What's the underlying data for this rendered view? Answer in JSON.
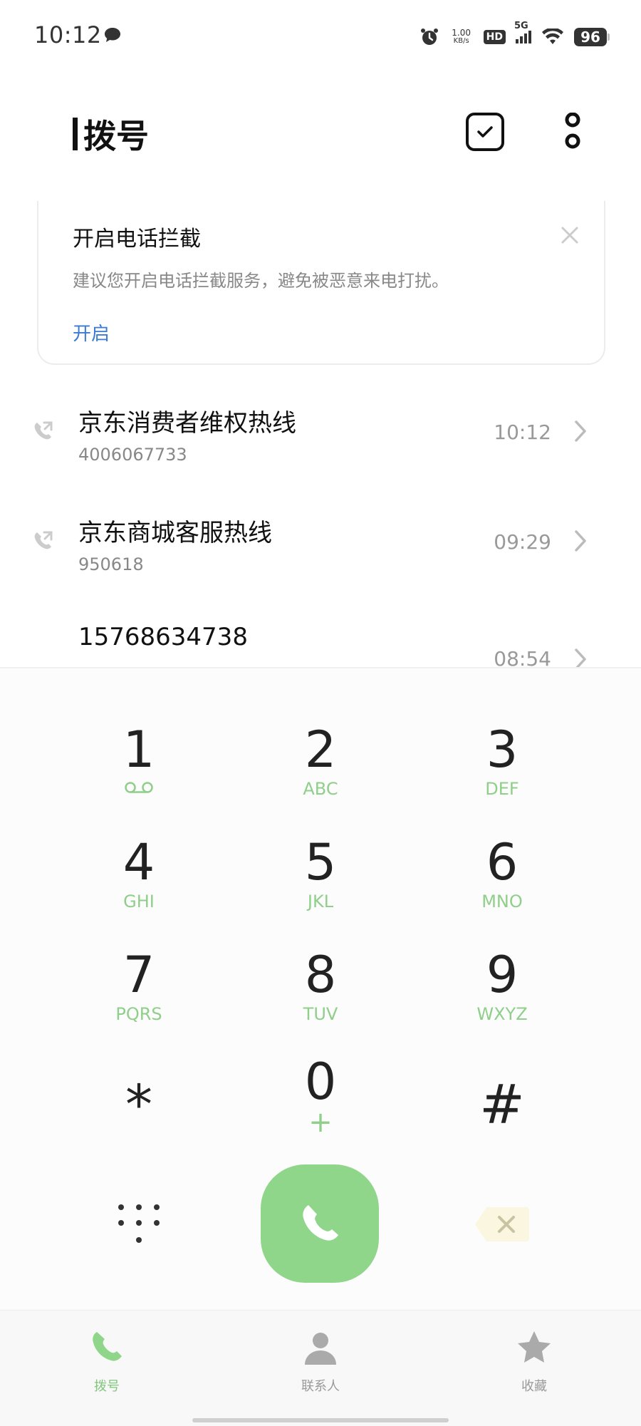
{
  "status_bar": {
    "time": "10:12",
    "speed_value": "1.00",
    "speed_unit": "KB/s",
    "hd_badge": "HD",
    "network": "5G",
    "battery": "96"
  },
  "header": {
    "title": "拨号"
  },
  "banner": {
    "title": "开启电话拦截",
    "description": "建议您开启电话拦截服务，避免被恶意来电打扰。",
    "action_label": "开启"
  },
  "call_log": [
    {
      "name": "京东消费者维权热线",
      "number": "4006067733",
      "time": "10:12"
    },
    {
      "name": "京东商城客服热线",
      "number": "950618",
      "time": "09:29"
    },
    {
      "name": "15768634738",
      "number": "",
      "time": "08:54"
    }
  ],
  "dialpad": {
    "keys": [
      {
        "digit": "1",
        "letters": ""
      },
      {
        "digit": "2",
        "letters": "ABC"
      },
      {
        "digit": "3",
        "letters": "DEF"
      },
      {
        "digit": "4",
        "letters": "GHI"
      },
      {
        "digit": "5",
        "letters": "JKL"
      },
      {
        "digit": "6",
        "letters": "MNO"
      },
      {
        "digit": "7",
        "letters": "PQRS"
      },
      {
        "digit": "8",
        "letters": "TUV"
      },
      {
        "digit": "9",
        "letters": "WXYZ"
      },
      {
        "digit": "*",
        "letters": ""
      },
      {
        "digit": "0",
        "letters": "+"
      },
      {
        "digit": "#",
        "letters": ""
      }
    ]
  },
  "bottom_nav": {
    "items": [
      {
        "label": "拨号",
        "icon": "phone-icon",
        "active": true
      },
      {
        "label": "联系人",
        "icon": "person-icon",
        "active": false
      },
      {
        "label": "收藏",
        "icon": "star-icon",
        "active": false
      }
    ]
  },
  "colors": {
    "accent_green": "#8fd68a",
    "link_blue": "#3a7bd5"
  }
}
